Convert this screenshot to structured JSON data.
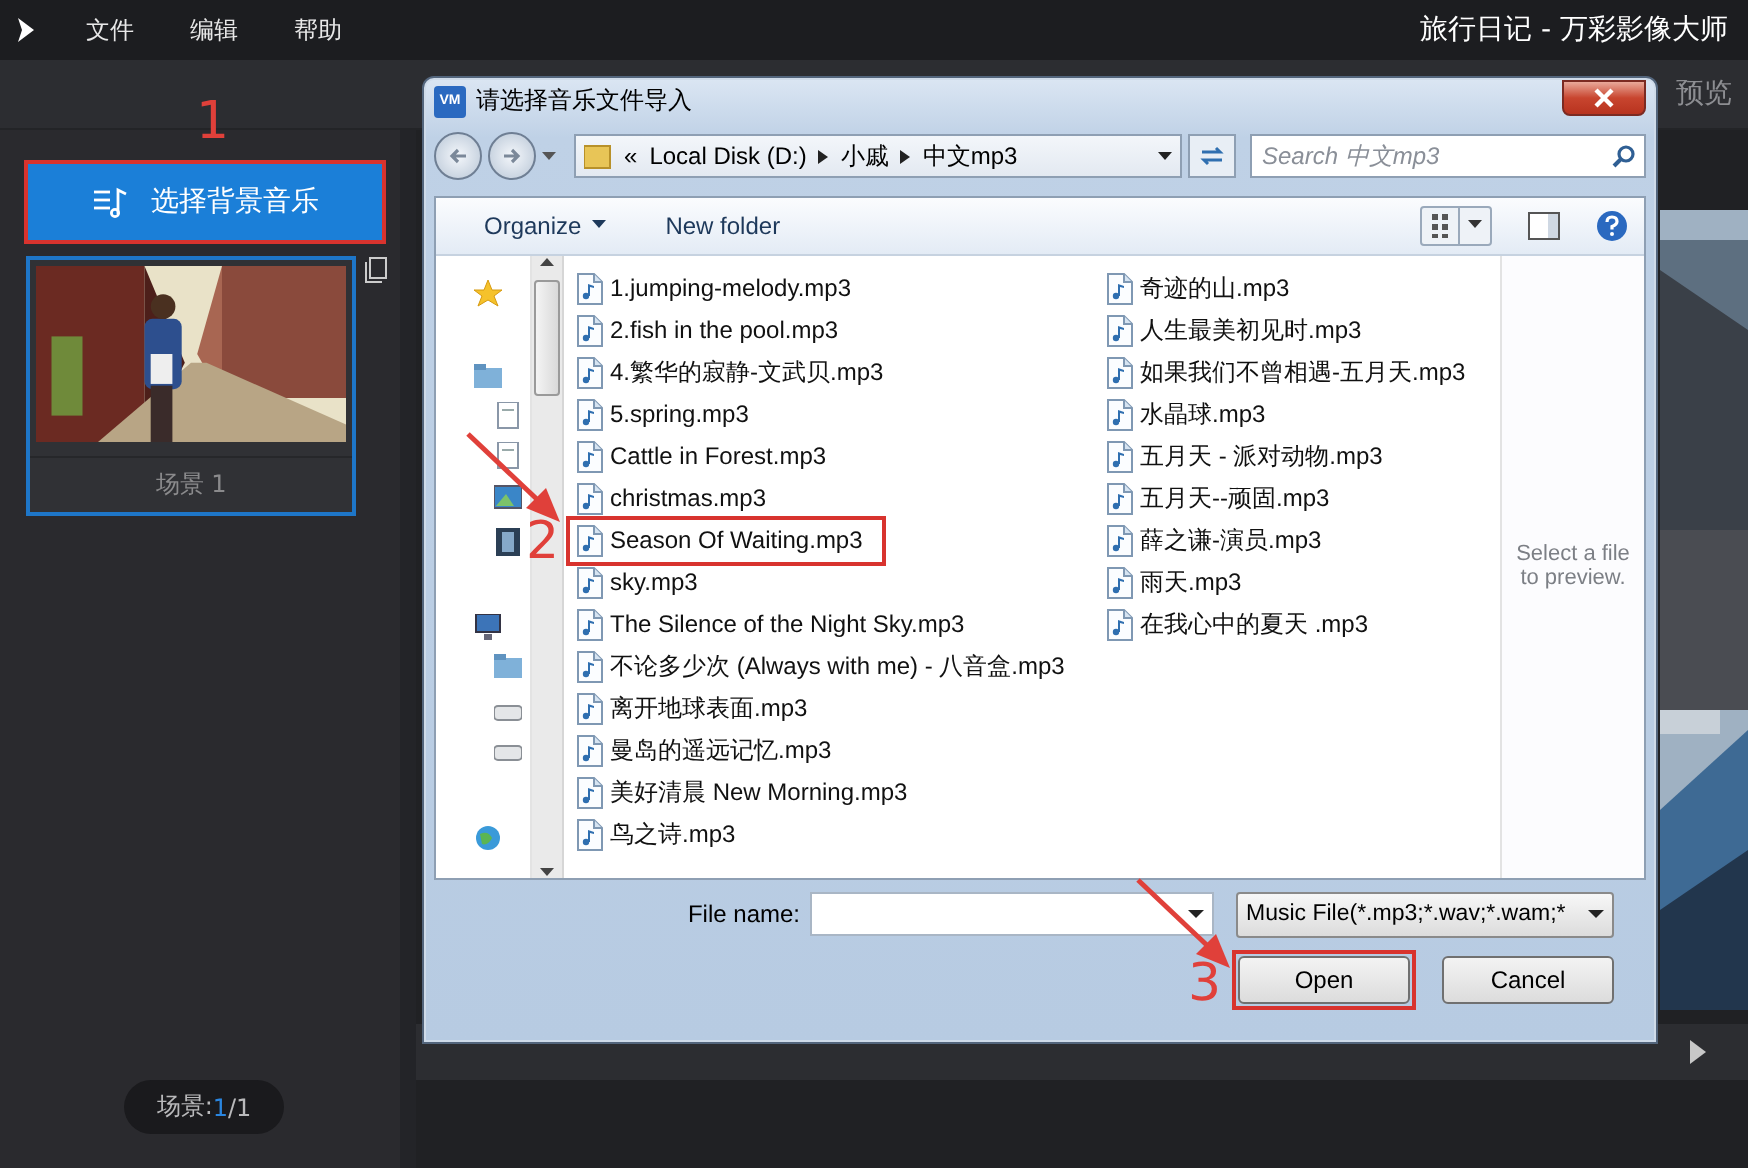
{
  "app": {
    "menu": [
      "文件",
      "编辑",
      "帮助"
    ],
    "title": "旅行日记 - 万彩影像大师",
    "toolbar_label": "预览"
  },
  "sidebar": {
    "music_button": {
      "label": "选择背景音乐",
      "annotation": {
        "number": "1"
      }
    },
    "scenes": [
      {
        "label": "场景 1",
        "selected": true
      }
    ],
    "scene_counter": {
      "label": "场景:",
      "current": "1",
      "total": "/1"
    }
  },
  "dialog": {
    "badge": "VM",
    "title": "请选择音乐文件导入",
    "path_prefix": "«",
    "path": [
      "Local Disk (D:)",
      "小戚",
      "中文mp3"
    ],
    "search": {
      "placeholder": "Search 中文mp3"
    },
    "toolbar": [
      "Organize",
      "New folder"
    ],
    "files": [
      {
        "name": "1.jumping-melody.mp3"
      },
      {
        "name": "2.fish in the pool.mp3"
      },
      {
        "name": "4.繁华的寂静-文武贝.mp3"
      },
      {
        "name": "5.spring.mp3"
      },
      {
        "name": "Cattle in Forest.mp3"
      },
      {
        "name": "christmas.mp3"
      },
      {
        "name": "Season Of Waiting.mp3",
        "annotation": {
          "number": "2",
          "arrow": true
        }
      },
      {
        "name": "sky.mp3"
      },
      {
        "name": "The Silence of the Night Sky.mp3"
      },
      {
        "name": "不论多少次 (Always with me) - 八音盒.mp3"
      },
      {
        "name": "离开地球表面.mp3"
      },
      {
        "name": "曼岛的遥远记忆.mp3"
      },
      {
        "name": "美好清晨 New Morning.mp3"
      },
      {
        "name": "鸟之诗.mp3"
      },
      {
        "name": "奇迹的山.mp3"
      },
      {
        "name": "人生最美初见时.mp3"
      },
      {
        "name": "如果我们不曾相遇-五月天.mp3"
      },
      {
        "name": "水晶球.mp3"
      },
      {
        "name": "五月天 - 派对动物.mp3"
      },
      {
        "name": "五月天--顽固.mp3"
      },
      {
        "name": "薛之谦-演员.mp3"
      },
      {
        "name": "雨天.mp3"
      },
      {
        "name": "在我心中的夏天 .mp3"
      }
    ],
    "preview_hint": "Select a file to preview.",
    "file_name_label": "File name:",
    "file_type": "Music File(*.mp3;*.wav;*.wam;*",
    "buttons": [
      {
        "label": "Open",
        "annotation": {
          "number": "3",
          "arrow": true
        }
      },
      {
        "label": "Cancel"
      }
    ]
  }
}
